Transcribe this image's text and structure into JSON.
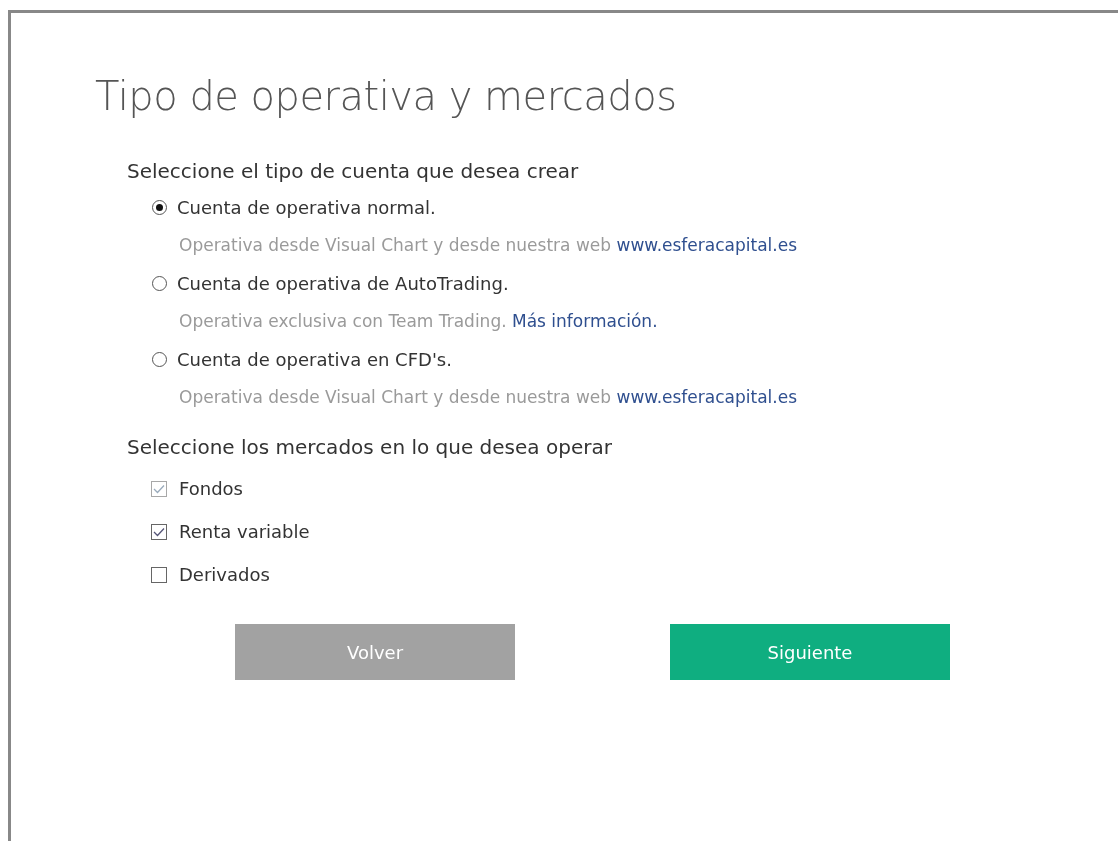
{
  "title": "Tipo de operativa y mercados",
  "account_section": {
    "heading": "Seleccione el tipo de cuenta que desea crear",
    "options": [
      {
        "label": "Cuenta de operativa normal.",
        "selected": true,
        "description": "Operativa desde Visual Chart y desde nuestra web",
        "link": "www.esferacapital.es"
      },
      {
        "label": "Cuenta de operativa de AutoTrading.",
        "selected": false,
        "description": "Operativa exclusiva con Team Trading.",
        "link": "Más información."
      },
      {
        "label": "Cuenta de operativa en CFD's.",
        "selected": false,
        "description": "Operativa desde Visual Chart y desde nuestra web",
        "link": "www.esferacapital.es"
      }
    ]
  },
  "markets_section": {
    "heading": "Seleccione los mercados en lo que desea operar",
    "markets": [
      {
        "label": "Fondos",
        "checked": true,
        "disabled": true
      },
      {
        "label": "Renta variable",
        "checked": true,
        "disabled": false
      },
      {
        "label": "Derivados",
        "checked": false,
        "disabled": false
      }
    ]
  },
  "buttons": [
    {
      "label": "Volver",
      "kind": "secondary"
    },
    {
      "label": "Siguiente",
      "kind": "primary"
    }
  ]
}
